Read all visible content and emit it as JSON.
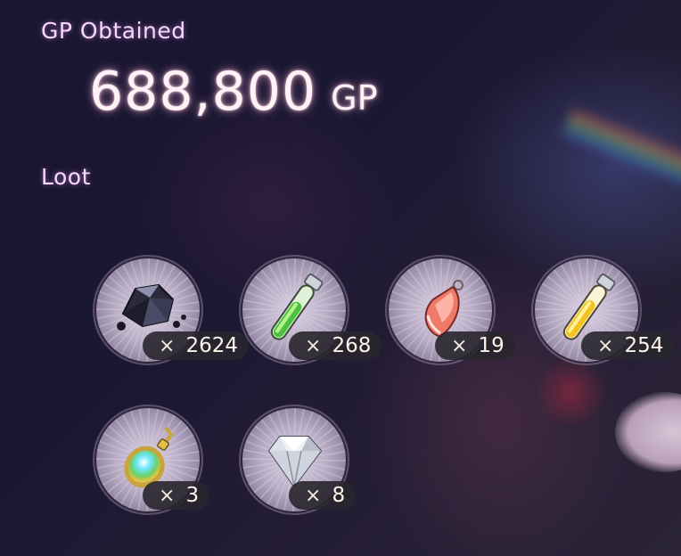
{
  "gp": {
    "label": "GP Obtained",
    "value": "688,800",
    "unit": "GP"
  },
  "loot": {
    "label": "Loot",
    "items": [
      {
        "name": "dark-ore",
        "icon": "dark-ore-icon",
        "prefix": "×",
        "count": "2624"
      },
      {
        "name": "green-potion",
        "icon": "green-vial-icon",
        "prefix": "×",
        "count": "268"
      },
      {
        "name": "red-crystal",
        "icon": "red-crystal-icon",
        "prefix": "×",
        "count": "19"
      },
      {
        "name": "yellow-potion",
        "icon": "yellow-vial-icon",
        "prefix": "×",
        "count": "254"
      },
      {
        "name": "rainbow-pendant",
        "icon": "rainbow-pendant-icon",
        "prefix": "×",
        "count": "3"
      },
      {
        "name": "diamond",
        "icon": "diamond-icon",
        "prefix": "×",
        "count": "8"
      }
    ]
  },
  "colors": {
    "label": "#f7d6ff",
    "amount": "#fff2f6",
    "badge_bg": "#28262d"
  }
}
